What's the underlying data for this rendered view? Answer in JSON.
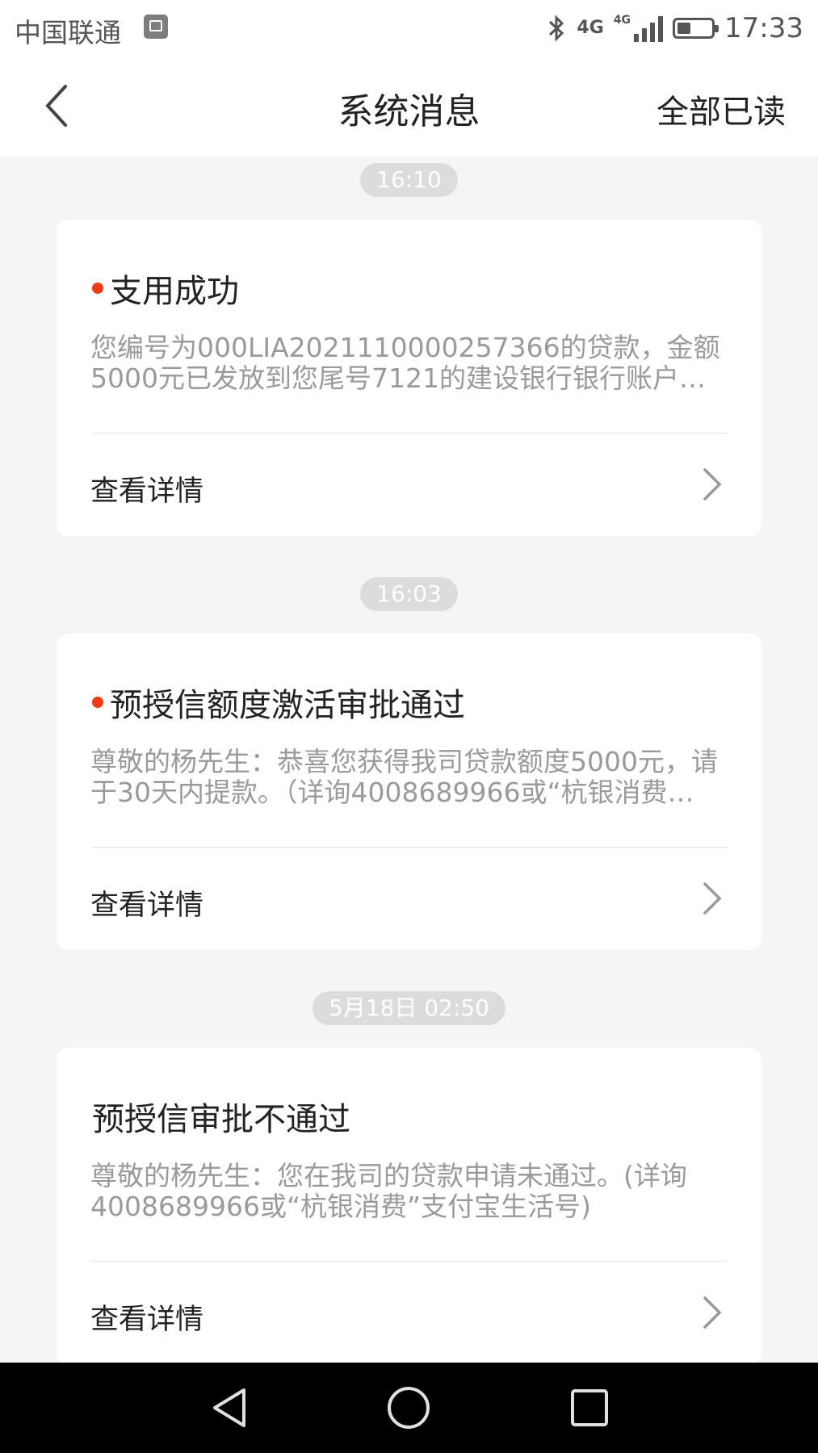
{
  "status_bar": {
    "carrier": "中国联通",
    "network_1": "4G",
    "network_2": "4G",
    "time": "17:33",
    "icons": [
      "image-icon",
      "bluetooth-icon",
      "signal-icon",
      "battery-icon"
    ]
  },
  "header": {
    "title": "系统消息",
    "action": "全部已读",
    "back_icon": "chevron-left-icon"
  },
  "messages": [
    {
      "time": "16:10",
      "unread": true,
      "title": "支用成功",
      "body": "您编号为000LIA2021110000257366的贷款，金额5000元已发放到您尾号7121的建设银行银行账户…",
      "detail_label": "查看详情"
    },
    {
      "time": "16:03",
      "unread": true,
      "title": "预授信额度激活审批通过",
      "body": "尊敬的杨先生：恭喜您获得我司贷款额度5000元，请于30天内提款。（详询4008689966或“杭银消费…",
      "detail_label": "查看详情"
    },
    {
      "time": "5月18日 02:50",
      "unread": false,
      "title": "预授信审批不通过",
      "body": "尊敬的杨先生：您在我司的贷款申请未通过。(详询4008689966或“杭银消费”支付宝生活号)",
      "detail_label": "查看详情"
    }
  ],
  "colors": {
    "unread_dot": "#f03c14",
    "background": "#f5f5f5",
    "card": "#ffffff",
    "time_pill": "#dcdcdc"
  },
  "nav_bar": {
    "icons": [
      "back-triangle-icon",
      "home-circle-icon",
      "recents-square-icon"
    ]
  }
}
